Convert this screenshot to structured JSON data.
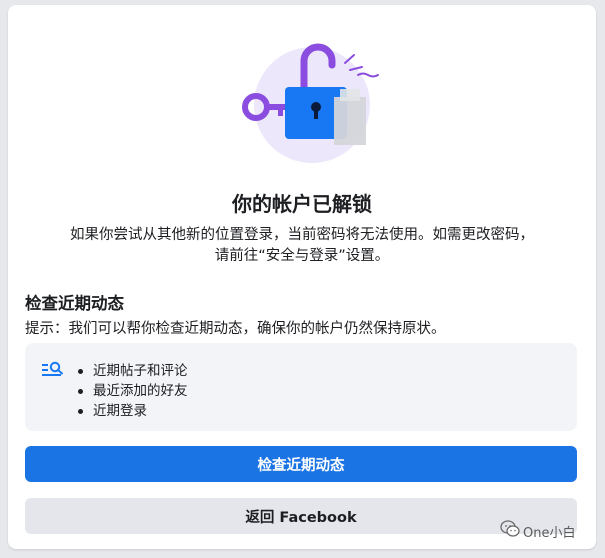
{
  "dialog": {
    "title": "你的帐户已解锁",
    "subtitle_line1": "如果你尝试从其他新的位置登录，当前密码将无法使用。如需更改密码，",
    "subtitle_line2": "请前往“安全与登录”设置。"
  },
  "review": {
    "heading": "检查近期动态",
    "hint": "提示：我们可以帮你检查近期动态，确保你的帐户仍然保持原状。",
    "items": [
      "近期帖子和评论",
      "最近添加的好友",
      "近期登录"
    ]
  },
  "buttons": {
    "primary": "检查近期动态",
    "secondary": "返回 Facebook"
  },
  "watermark": {
    "text": "One小白"
  },
  "colors": {
    "accent": "#1b74e4",
    "lock_purple": "#8a4ddf",
    "circle_bg": "#ede7fb",
    "panel_bg": "#f2f4f7",
    "secondary_btn": "#e4e6eb"
  },
  "icons": {
    "illustration": "unlocked-padlock-key-icon",
    "panel": "search-list-icon",
    "watermark": "wechat-icon"
  }
}
